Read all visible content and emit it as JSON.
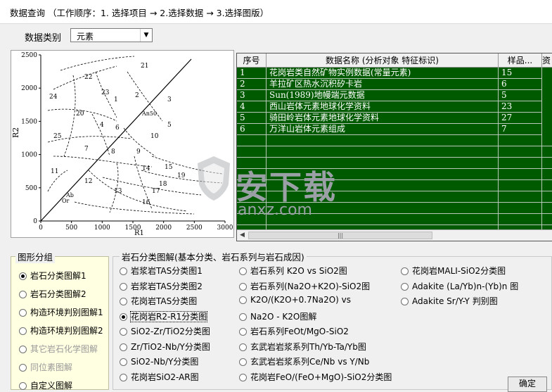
{
  "window": {
    "title": "数据查询 （工作顺序：1. 选择项目 → 2.选择数据 → 3.选择图版）"
  },
  "data_type": {
    "label": "数据类别",
    "value": "元素"
  },
  "chart": {
    "ylabel": "R2",
    "xlabel": "R1",
    "x_ticks": [
      "0",
      "500",
      "1000",
      "1500",
      "2000",
      "2500",
      "3000"
    ],
    "y_ticks": [
      "0",
      "500",
      "1000",
      "1500",
      "2000",
      "2500"
    ],
    "field_labels": [
      "21",
      "22",
      "23",
      "24",
      "1",
      "2",
      "3",
      "20",
      "4",
      "An50",
      "5",
      "25",
      "6",
      "7",
      "8",
      "9",
      "10",
      "11",
      "12",
      "13",
      "14",
      "15",
      "16",
      "17",
      "18",
      "19",
      "Ab",
      "Or"
    ]
  },
  "table": {
    "headers": [
      "序号",
      "数据名称 (分析对象 特征标识)",
      "样品...",
      "资"
    ],
    "rows": [
      [
        "1",
        "花岗岩类自然矿物实例数据(常量元素)",
        "15"
      ],
      [
        "2",
        "羊拉矿区热水沉积矽卡岩",
        "6"
      ],
      [
        "3",
        "Sun(1989)地幔端元数据",
        "5"
      ],
      [
        "4",
        "西山岩体元素地球化学资料",
        "23"
      ],
      [
        "5",
        "骑田岭岩体元素地球化学资料",
        "27"
      ],
      [
        "6",
        "万洋山岩体元素组成",
        "7"
      ]
    ]
  },
  "watermark": {
    "text": "安下载",
    "url": "anxz.com"
  },
  "groups": {
    "title": "图形分组",
    "items": [
      {
        "label": "岩石分类图解1",
        "selected": true,
        "enabled": true
      },
      {
        "label": "岩石分类图解2",
        "selected": false,
        "enabled": true
      },
      {
        "label": "构造环境判别图解1",
        "selected": false,
        "enabled": true
      },
      {
        "label": "构造环境判别图解2",
        "selected": false,
        "enabled": true
      },
      {
        "label": "其它岩石化学图解",
        "selected": false,
        "enabled": false
      },
      {
        "label": "同位素图解",
        "selected": false,
        "enabled": false
      },
      {
        "label": "自定义图解",
        "selected": false,
        "enabled": true
      }
    ]
  },
  "diagrams": {
    "title": "岩石分类图解(基本分类、岩石系列与岩石成因)",
    "col1": [
      {
        "label": "岩浆岩TAS分类图1",
        "selected": false
      },
      {
        "label": "岩浆岩TAS分类图2",
        "selected": false
      },
      {
        "label": "花岗岩TAS分类图",
        "selected": false
      },
      {
        "label": "花岗岩R2-R1分类图",
        "selected": true
      },
      {
        "label": "SiO2-Zr/TiO2分类图",
        "selected": false
      },
      {
        "label": "Zr/TiO2-Nb/Y分类图",
        "selected": false
      },
      {
        "label": "SiO2-Nb/Y分类图",
        "selected": false
      },
      {
        "label": "花岗岩SiO2-AR图",
        "selected": false
      }
    ],
    "col2": [
      {
        "label": "岩石系列 K2O vs SiO2图",
        "selected": false
      },
      {
        "label": "岩石系列(Na2O+K2O)-SiO2图",
        "selected": false
      },
      {
        "label": "K2O/(K2O+0.7Na2O) vs",
        "selected": false
      },
      {
        "label": "Na2O - K2O图解",
        "selected": false
      },
      {
        "label": "岩石系列FeOt/MgO-SiO2",
        "selected": false
      },
      {
        "label": "玄武岩岩浆系列Th/Yb-Ta/Yb图",
        "selected": false
      },
      {
        "label": "玄武岩岩浆系列Ce/Nb vs Y/Nb",
        "selected": false
      },
      {
        "label": "花岗岩FeO/(FeO+MgO)-SiO2分类图",
        "selected": false
      }
    ],
    "col3": [
      {
        "label": "花岗岩MALI-SiO2分类图",
        "selected": false
      },
      {
        "label": "Adakite (La/Yb)n-(Yb)n 图",
        "selected": false
      },
      {
        "label": "Adakite Sr/Y-Y 判别图",
        "selected": false
      }
    ]
  },
  "ok_button": {
    "label": "确定"
  }
}
